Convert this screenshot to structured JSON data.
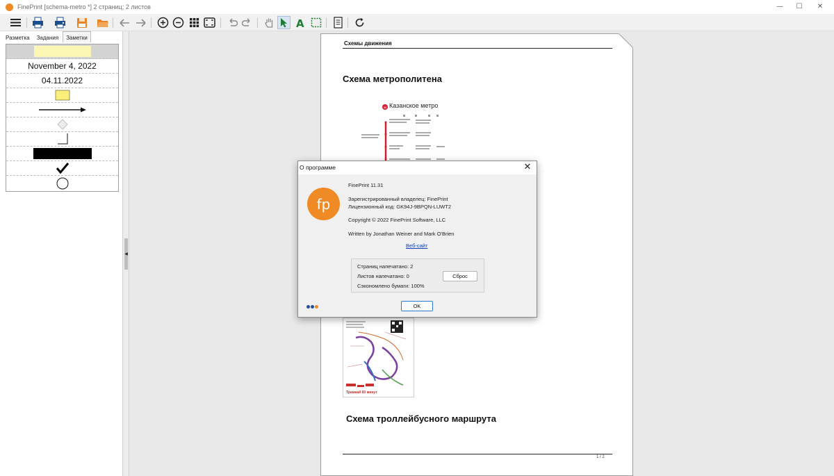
{
  "window": {
    "title": "FinePrint [schema-metro *] 2 страниц; 2 листов",
    "controls": [
      "minimize",
      "maximize",
      "close"
    ]
  },
  "toolbar": {
    "buttons": [
      {
        "name": "menu-icon"
      },
      {
        "name": "print-icon"
      },
      {
        "name": "fax-print-icon"
      },
      {
        "name": "save-icon"
      },
      {
        "name": "open-folder-icon"
      },
      {
        "name": "back-arrow-icon"
      },
      {
        "name": "forward-arrow-icon"
      },
      {
        "name": "zoom-in-icon"
      },
      {
        "name": "zoom-out-icon"
      },
      {
        "name": "grid-view-icon"
      },
      {
        "name": "fit-page-icon"
      },
      {
        "name": "undo-icon"
      },
      {
        "name": "redo-icon"
      },
      {
        "name": "hand-tool-icon"
      },
      {
        "name": "select-arrow-icon",
        "active": true
      },
      {
        "name": "text-tool-icon"
      },
      {
        "name": "marquee-select-icon"
      },
      {
        "name": "page-setup-icon"
      },
      {
        "name": "refresh-icon"
      }
    ]
  },
  "left_panel": {
    "tabs": [
      {
        "label": "Разметка",
        "active": false
      },
      {
        "label": "Задания",
        "active": false
      },
      {
        "label": "Заметки",
        "active": true
      }
    ],
    "notes": [
      {
        "kind": "yellow-highlight"
      },
      {
        "kind": "text",
        "text": "November 4, 2022"
      },
      {
        "kind": "text",
        "text": "04.11.2022"
      },
      {
        "kind": "sticky-note"
      },
      {
        "kind": "arrow"
      },
      {
        "kind": "diamond"
      },
      {
        "kind": "corner-line"
      },
      {
        "kind": "black-bar"
      },
      {
        "kind": "checkmark"
      },
      {
        "kind": "circle"
      }
    ]
  },
  "document": {
    "header": "Схемы движения",
    "heading_metro": "Схема метрополитена",
    "metro_map_title": "Казанское метро",
    "heading_trolley": "Схема троллейбусного маршрута",
    "tram_caption": "Трамвай 60 минут",
    "page_number": "1 / 2"
  },
  "about_dialog": {
    "title": "О программе",
    "product": "FinePrint 11.31",
    "owner_line": "Зарегистрированный владелец:  FinePrint",
    "license_line": "Лицензионный код:  GK94J-9BPQN-LUWT2",
    "copyright": "Copyright © 2022 FinePrint Software, LLC",
    "authors": "Written by Jonathan Weiner and Mark O'Brien",
    "website_link": "Веб-сайт",
    "logo_text": "fp",
    "stats": {
      "pages_printed": "Страниц напечатано:  2",
      "sheets_printed": "Листов напечатано:    0",
      "paper_saved": "Сэкономлено бумаги:  100%"
    },
    "reset_label": "Сброс",
    "ok_label": "OK",
    "dot_colors": [
      "#1f4f9e",
      "#1f4f9e",
      "#f08a24"
    ]
  },
  "colors": {
    "brand_orange": "#f08a24",
    "accent_blue": "#2b79d7"
  }
}
